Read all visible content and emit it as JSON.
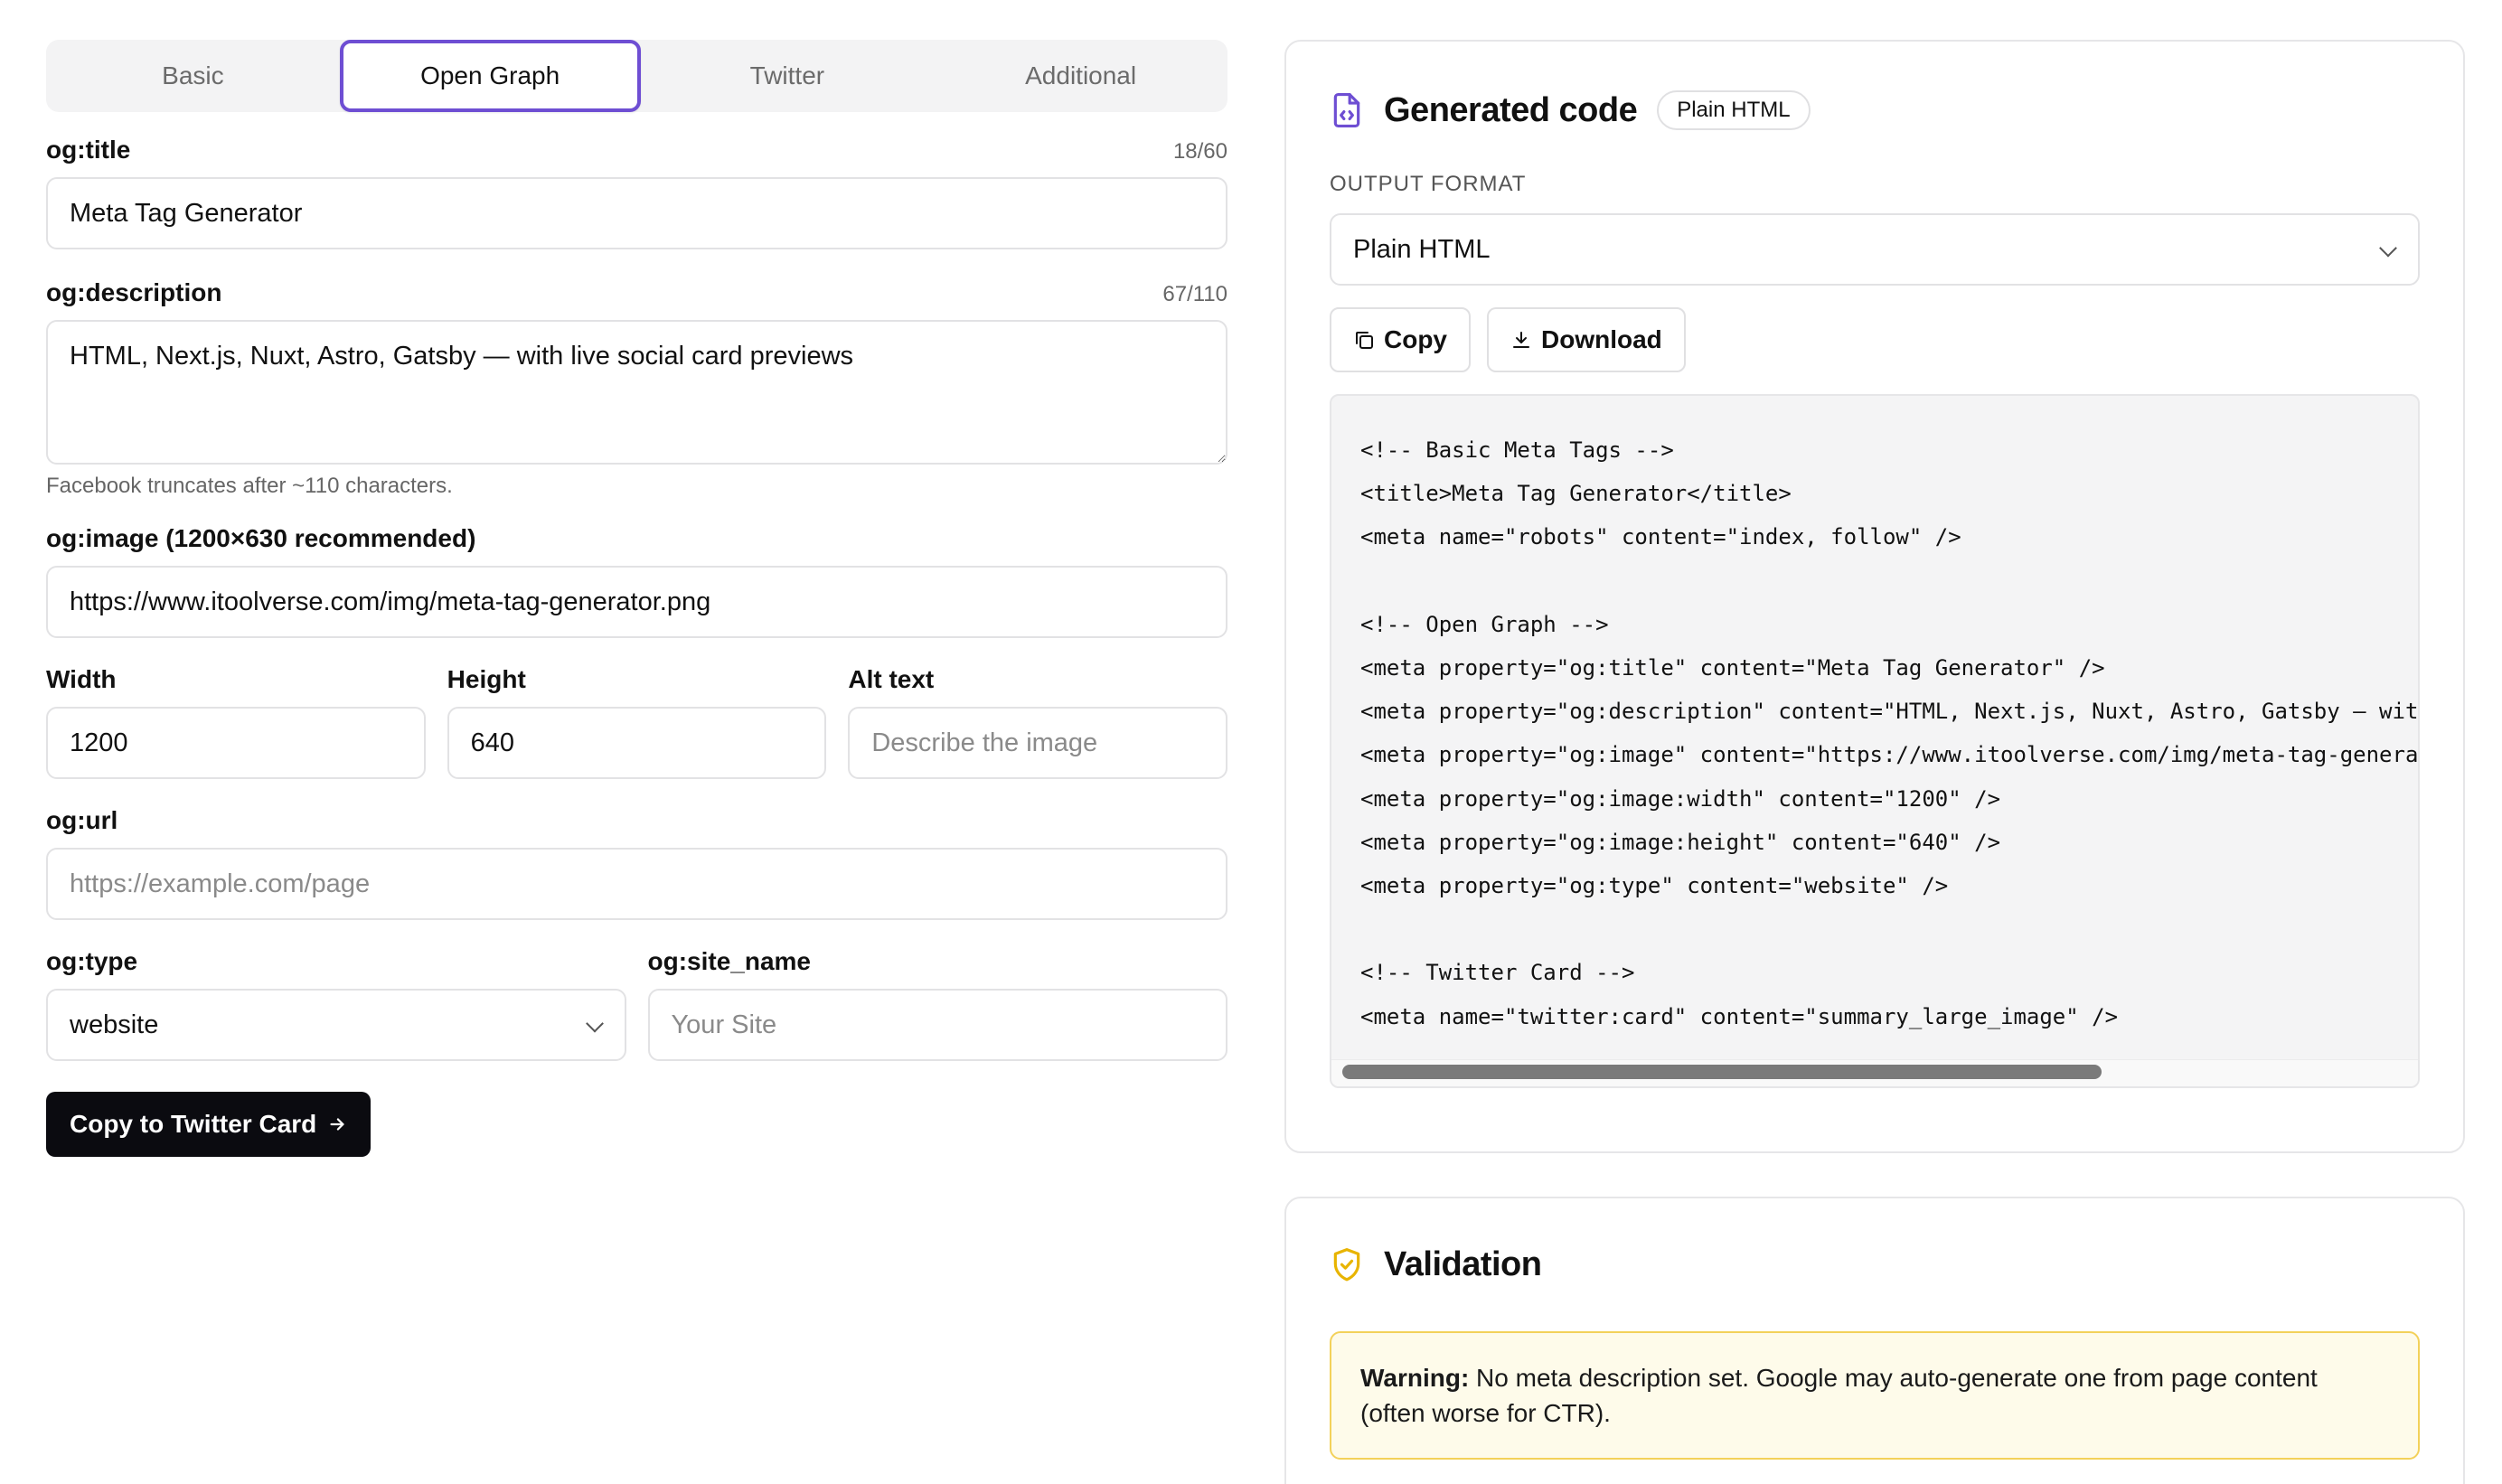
{
  "tabs": [
    {
      "label": "Basic",
      "active": false
    },
    {
      "label": "Open Graph",
      "active": true
    },
    {
      "label": "Twitter",
      "active": false
    },
    {
      "label": "Additional",
      "active": false
    }
  ],
  "og_title": {
    "label": "og:title",
    "counter": "18/60",
    "value": "Meta Tag Generator"
  },
  "og_description": {
    "label": "og:description",
    "counter": "67/110",
    "value": "HTML, Next.js, Nuxt, Astro, Gatsby — with live social card previews",
    "hint": "Facebook truncates after ~110 characters."
  },
  "og_image": {
    "label": "og:image (1200×630 recommended)",
    "value": "https://www.itoolverse.com/img/meta-tag-generator.png"
  },
  "width": {
    "label": "Width",
    "value": "1200"
  },
  "height": {
    "label": "Height",
    "value": "640"
  },
  "alt_text": {
    "label": "Alt text",
    "placeholder": "Describe the image"
  },
  "og_url": {
    "label": "og:url",
    "placeholder": "https://example.com/page"
  },
  "og_type": {
    "label": "og:type",
    "value": "website"
  },
  "og_site_name": {
    "label": "og:site_name",
    "placeholder": "Your Site"
  },
  "copy_twitter_button": {
    "label": "Copy to Twitter Card",
    "icon": "arrow-right-icon"
  },
  "generated": {
    "title": "Generated code",
    "badge": "Plain HTML",
    "icon": "file-code-icon",
    "output_format_label": "OUTPUT FORMAT",
    "output_format_value": "Plain HTML",
    "copy_label": "Copy",
    "download_label": "Download",
    "code_lines": [
      "<!-- Basic Meta Tags -->",
      "<title>Meta Tag Generator</title>",
      "<meta name=\"robots\" content=\"index, follow\" />",
      "",
      "<!-- Open Graph -->",
      "<meta property=\"og:title\" content=\"Meta Tag Generator\" />",
      "<meta property=\"og:description\" content=\"HTML, Next.js, Nuxt, Astro, Gatsby — wit",
      "<meta property=\"og:image\" content=\"https://www.itoolverse.com/img/meta-tag-genera",
      "<meta property=\"og:image:width\" content=\"1200\" />",
      "<meta property=\"og:image:height\" content=\"640\" />",
      "<meta property=\"og:type\" content=\"website\" />",
      "",
      "<!-- Twitter Card -->",
      "<meta name=\"twitter:card\" content=\"summary_large_image\" />"
    ]
  },
  "validation": {
    "title": "Validation",
    "icon": "shield-check-icon",
    "warning_prefix": "Warning:",
    "warning_text": " No meta description set. Google may auto-generate one from page content (often worse for CTR)."
  },
  "colors": {
    "accent": "#6e4ed3",
    "warning_border": "#f3d15a",
    "warning_bg": "#fefbea",
    "shield": "#e8b400"
  }
}
